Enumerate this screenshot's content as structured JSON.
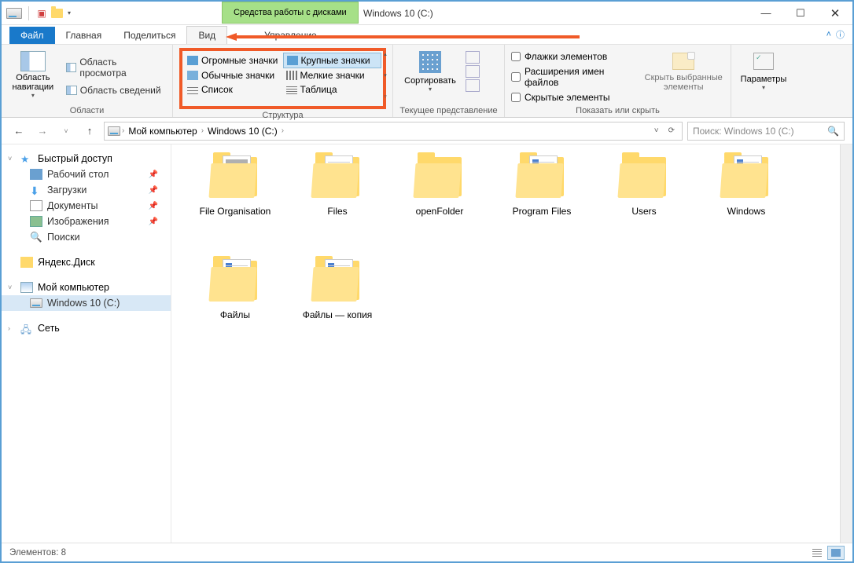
{
  "titlebar": {
    "context_tab": "Средства работы с дисками",
    "title": "Windows 10 (C:)"
  },
  "tabs": {
    "file": "Файл",
    "home": "Главная",
    "share": "Поделиться",
    "view": "Вид",
    "manage": "Управление"
  },
  "ribbon": {
    "panes": {
      "label": "Области",
      "navigation": "Область навигации",
      "preview": "Область просмотра",
      "details": "Область сведений"
    },
    "layout": {
      "label": "Структура",
      "huge": "Огромные значки",
      "large": "Крупные значки",
      "medium": "Обычные значки",
      "small": "Мелкие значки",
      "list": "Список",
      "details": "Таблица"
    },
    "current_view": {
      "label": "Текущее представление",
      "sort": "Сортировать"
    },
    "show_hide": {
      "label": "Показать или скрыть",
      "checkboxes": "Флажки элементов",
      "extensions": "Расширения имен файлов",
      "hidden": "Скрытые элементы",
      "hide_selected": "Скрыть выбранные элементы"
    },
    "options": "Параметры"
  },
  "address": {
    "root": "Мой компьютер",
    "drive": "Windows 10 (C:)"
  },
  "search": {
    "placeholder": "Поиск: Windows 10 (C:)"
  },
  "sidebar": {
    "quick_access": "Быстрый доступ",
    "desktop": "Рабочий стол",
    "downloads": "Загрузки",
    "documents": "Документы",
    "pictures": "Изображения",
    "searches": "Поиски",
    "yandex": "Яндекс.Диск",
    "this_pc": "Мой компьютер",
    "drive_c": "Windows 10 (C:)",
    "network": "Сеть"
  },
  "files": [
    {
      "name": "File Organisation",
      "kind": "photo"
    },
    {
      "name": "Files",
      "kind": "docs"
    },
    {
      "name": "openFolder",
      "kind": "plain"
    },
    {
      "name": "Program Files",
      "kind": "stripe"
    },
    {
      "name": "Users",
      "kind": "plain"
    },
    {
      "name": "Windows",
      "kind": "stripe"
    },
    {
      "name": "Файлы",
      "kind": "stripe"
    },
    {
      "name": "Файлы — копия",
      "kind": "stripe"
    }
  ],
  "status": {
    "count_label": "Элементов: 8"
  }
}
